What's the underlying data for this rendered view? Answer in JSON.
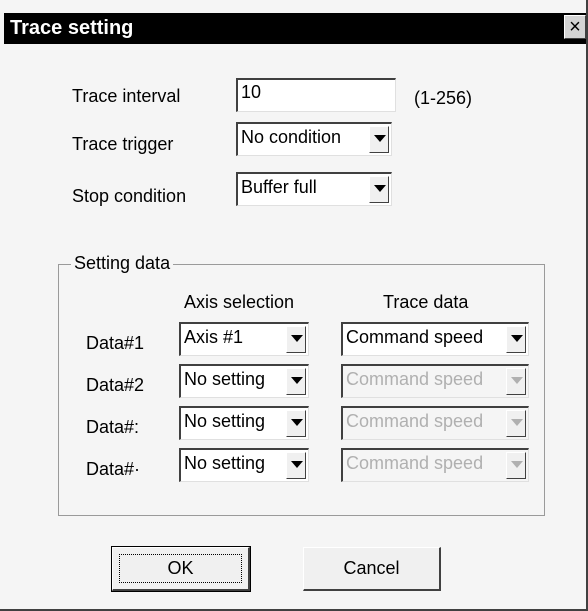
{
  "dialog": {
    "title": "Trace setting",
    "close_glyph": "×",
    "trace_interval": {
      "label": "Trace interval",
      "value": "10",
      "range": "(1-256)"
    },
    "trace_trigger": {
      "label": "Trace trigger",
      "value": "No condition"
    },
    "stop_condition": {
      "label": "Stop condition",
      "value": "Buffer full"
    },
    "setting_data": {
      "legend": "Setting data",
      "axis_header": "Axis selection",
      "trace_header": "Trace data",
      "rows": [
        {
          "label": "Data#1",
          "axis": "Axis #1",
          "trace": "Command speed"
        },
        {
          "label": "Data#2",
          "axis": "No setting",
          "trace": "Command speed"
        },
        {
          "label": "Data#:",
          "axis": "No setting",
          "trace": "Command speed"
        },
        {
          "label": "Data#·",
          "axis": "No setting",
          "trace": "Command speed"
        }
      ]
    },
    "ok_label": "OK",
    "cancel_label": "Cancel"
  }
}
